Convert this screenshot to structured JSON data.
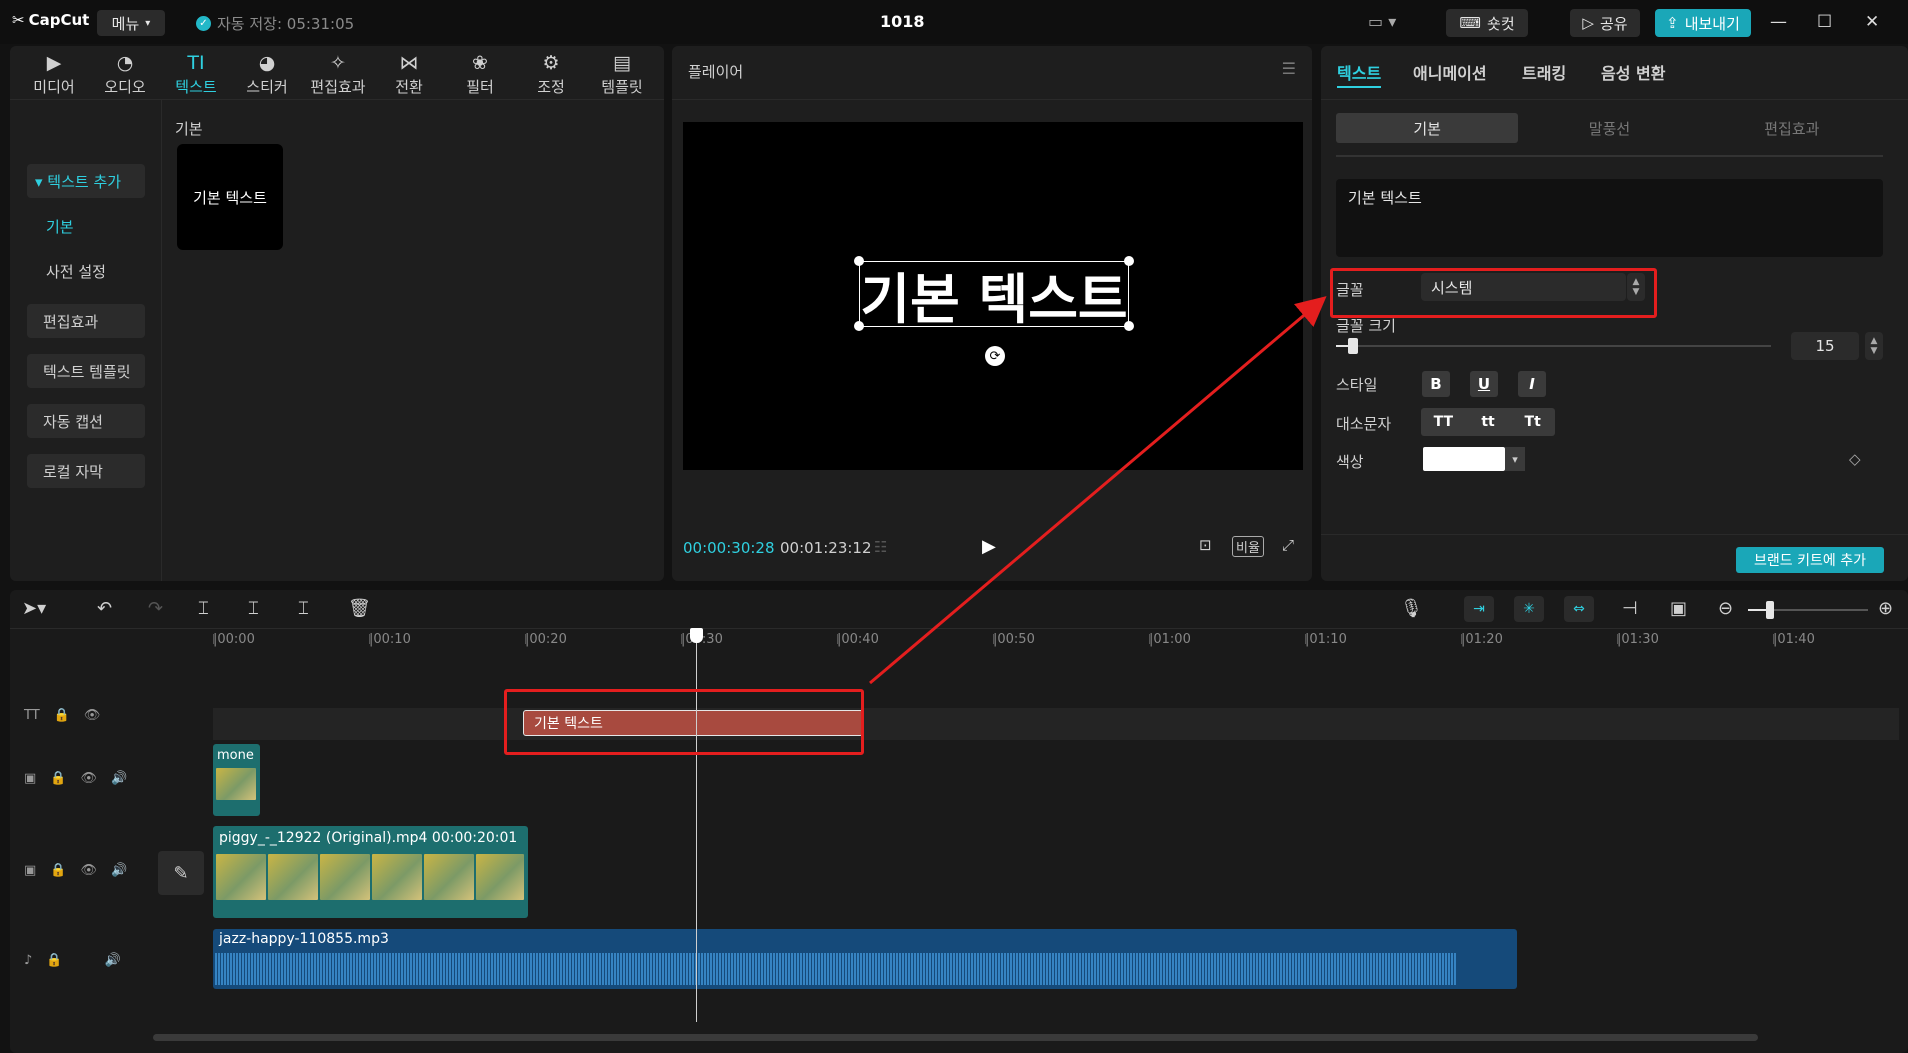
{
  "titlebar": {
    "logo": "CapCut",
    "menu_label": "메뉴",
    "autosave": "자동 저장: 05:31:05",
    "project_title": "1018",
    "shortcut_label": "숏컷",
    "share_label": "공유",
    "export_label": "내보내기"
  },
  "media_tools": [
    {
      "label": "미디어",
      "icon": "media-icon"
    },
    {
      "label": "오디오",
      "icon": "audio-icon"
    },
    {
      "label": "텍스트",
      "icon": "text-icon",
      "active": true
    },
    {
      "label": "스티커",
      "icon": "sticker-icon"
    },
    {
      "label": "편집효과",
      "icon": "effects-icon"
    },
    {
      "label": "전환",
      "icon": "transition-icon"
    },
    {
      "label": "필터",
      "icon": "filter-icon"
    },
    {
      "label": "조정",
      "icon": "adjust-icon"
    },
    {
      "label": "템플릿",
      "icon": "template-icon"
    }
  ],
  "text_sidebar": {
    "add_text": "▾ 텍스트 추가",
    "sub_basic": "기본",
    "sub_preset": "사전 설정",
    "effects": "편집효과",
    "template": "텍스트 템플릿",
    "auto_caption": "자동 캡션",
    "local_caption": "로컬 자막"
  },
  "text_library": {
    "section": "기본",
    "card_label": "기본 텍스트"
  },
  "player": {
    "title": "플레이어",
    "overlay_text": "기본 텍스트",
    "current_time": "00:00:30:28",
    "total_time": "00:01:23:12",
    "ratio_label": "비율"
  },
  "inspector": {
    "tabs": [
      "텍스트",
      "애니메이션",
      "트래킹",
      "음성 변환"
    ],
    "segments": [
      "기본",
      "말풍선",
      "편집효과"
    ],
    "text_value": "기본 텍스트",
    "font_label": "글꼴",
    "font_value": "시스템",
    "font_size_label": "글꼴 크기",
    "font_size_value": "15",
    "font_size_fraction": 0.04,
    "style_label": "스타일",
    "style_buttons": [
      "B",
      "U",
      "I"
    ],
    "case_label": "대소문자",
    "case_buttons": [
      "TT",
      "tt",
      "Tt"
    ],
    "color_label": "색상",
    "color_value": "#ffffff",
    "brand_button": "브랜드 키트에 추가"
  },
  "timeline": {
    "ruler": [
      "|00:00",
      "|00:10",
      "|00:20",
      "|00:30",
      "|00:40",
      "|00:50",
      "|01:00",
      "|01:10",
      "|01:20",
      "|01:30",
      "|01:40"
    ],
    "text_clip": "기본 텍스트",
    "mone_clip": "mone",
    "piggy_clip": "piggy_-_12922 (Original).mp4  00:00:20:01",
    "audio_clip": "jazz-happy-110855.mp3"
  },
  "colors": {
    "accent": "#2fd0e0",
    "export": "#1aa7b8",
    "annotation": "#e41e1e",
    "text_clip": "#a84a3f"
  }
}
